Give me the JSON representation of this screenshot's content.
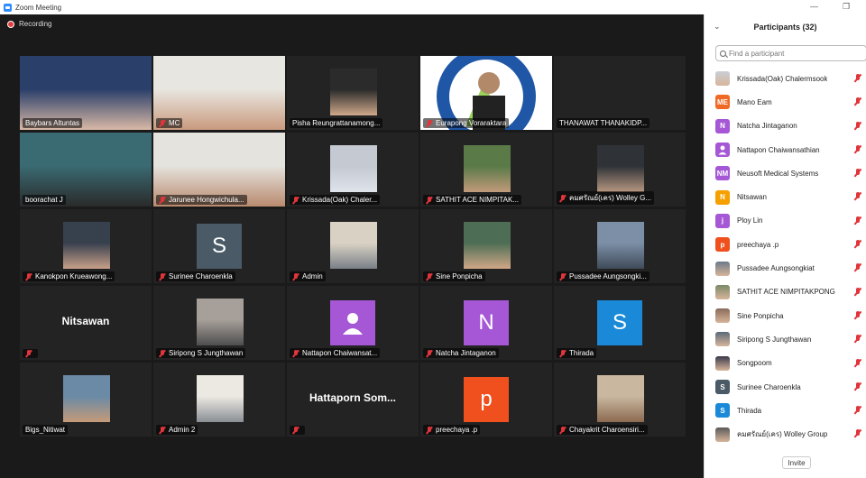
{
  "window": {
    "title": "Zoom Meeting",
    "minimize": "—",
    "maximize": "❐"
  },
  "recording": {
    "label": "Recording"
  },
  "colors": {
    "accent": "#2d8cff",
    "mute": "#e0353b",
    "active_speaker": "#b8e06a",
    "background": "#1a1a1a"
  },
  "grid": {
    "tiles": [
      {
        "name": "Baybars Altuntas",
        "kind": "photo",
        "muted": false,
        "active": true
      },
      {
        "name": "MC",
        "kind": "photo",
        "muted": true
      },
      {
        "name": "Pisha Reungrattanamong...",
        "kind": "photo",
        "muted": false
      },
      {
        "name": "Eurapong Voraraktara",
        "kind": "photo",
        "muted": true
      },
      {
        "name": "THANAWAT THANAKIDP...",
        "kind": "blank",
        "muted": false
      },
      {
        "name": "boorachat J",
        "kind": "photo",
        "muted": false
      },
      {
        "name": "Jarunee Hongwichula...",
        "kind": "photo",
        "muted": true
      },
      {
        "name": "Krissada(Oak) Chaler...",
        "kind": "photo",
        "muted": true
      },
      {
        "name": "SATHIT ACE NIMPITAK...",
        "kind": "photo",
        "muted": true
      },
      {
        "name": "คมศรัณย์(เคร) Wolley G...",
        "kind": "photo",
        "muted": true
      },
      {
        "name": "Kanokpon Krueawong...",
        "kind": "photo",
        "muted": true
      },
      {
        "name": "Surinee Charoenkla",
        "kind": "avatar",
        "letter": "S",
        "color": "#4a5a66",
        "muted": true
      },
      {
        "name": "Admin",
        "kind": "photo",
        "muted": true
      },
      {
        "name": "Sine Ponpicha",
        "kind": "photo",
        "muted": true
      },
      {
        "name": "Pussadee Aungsongki...",
        "kind": "photo",
        "muted": true
      },
      {
        "name": "",
        "big_name": "Nitsawan",
        "kind": "text",
        "muted": true
      },
      {
        "name": "Siripong S Jungthawan",
        "kind": "photo",
        "muted": true
      },
      {
        "name": "Nattapon Chaiwansat...",
        "kind": "avatar-person",
        "color": "#a557d6",
        "muted": true
      },
      {
        "name": "Natcha Jintaganon",
        "kind": "avatar",
        "letter": "N",
        "color": "#a557d6",
        "muted": true
      },
      {
        "name": "Thirada",
        "kind": "avatar",
        "letter": "S",
        "color": "#1a8ad8",
        "muted": true
      },
      {
        "name": "Bigs_Nitiwat",
        "kind": "photo",
        "muted": false
      },
      {
        "name": "Admin 2",
        "kind": "photo",
        "muted": true
      },
      {
        "name": "",
        "big_name": "Hattaporn  Som...",
        "kind": "text",
        "muted": true
      },
      {
        "name": "preechaya .p",
        "kind": "avatar",
        "letter": "p",
        "color": "#f0501e",
        "muted": true
      },
      {
        "name": "Chayakrit Charoensiri...",
        "kind": "photo",
        "muted": true
      }
    ]
  },
  "sidebar": {
    "title": "Participants (32)",
    "search_placeholder": "Find a participant",
    "invite_label": "Invite",
    "participants": [
      {
        "name": "Krissada(Oak) Chalermsook",
        "avatar": "photo",
        "color": "#c9cfd8"
      },
      {
        "name": "Mano Eam",
        "avatar": "ME",
        "color": "#f06a25"
      },
      {
        "name": "Natcha Jintaganon",
        "avatar": "N",
        "color": "#a557d6"
      },
      {
        "name": "Nattapon Chaiwansathian",
        "avatar": "person",
        "color": "#a557d6"
      },
      {
        "name": "Neusoft Medical Systems",
        "avatar": "NM",
        "color": "#a557d6"
      },
      {
        "name": "Nitsawan",
        "avatar": "N",
        "color": "#f5a000"
      },
      {
        "name": "Ploy Lin",
        "avatar": "j",
        "color": "#a557d6"
      },
      {
        "name": "preechaya .p",
        "avatar": "p",
        "color": "#f0501e"
      },
      {
        "name": "Pussadee Aungsongkiat",
        "avatar": "photo",
        "color": "#6b7a88"
      },
      {
        "name": "SATHIT ACE NIMPITAKPONG",
        "avatar": "photo",
        "color": "#7a8a6a"
      },
      {
        "name": "Sine Ponpicha",
        "avatar": "photo",
        "color": "#8a6a5a"
      },
      {
        "name": "Siripong S Jungthawan",
        "avatar": "photo",
        "color": "#5a6a7a"
      },
      {
        "name": "Songpoom",
        "avatar": "photo",
        "color": "#3a3a4a"
      },
      {
        "name": "Surinee Charoenkla",
        "avatar": "S",
        "color": "#4a5a66"
      },
      {
        "name": "Thirada",
        "avatar": "S",
        "color": "#1a8ad8"
      },
      {
        "name": "คมศรัณย์(เคร) Wolley Group",
        "avatar": "photo",
        "color": "#5a5a5a"
      }
    ]
  }
}
